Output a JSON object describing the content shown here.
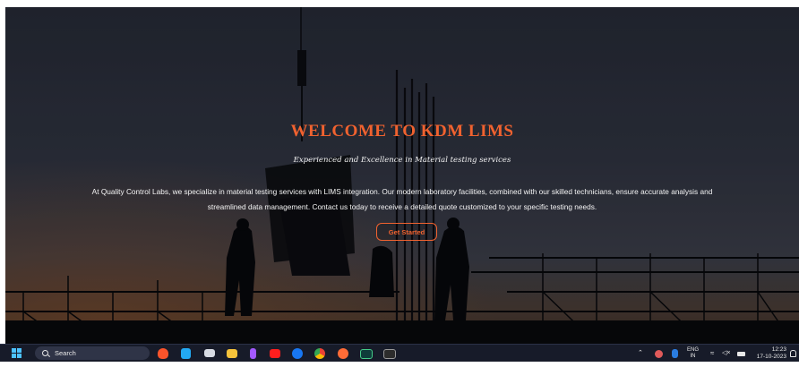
{
  "hero": {
    "title": "WELCOME TO KDM LIMS",
    "subtitle": "Experienced and Excellence in Material testing services",
    "description": "At Quality Control Labs, we specialize in material testing services with LIMS integration. Our modern laboratory facilities, combined with our skilled technicians, ensure accurate analysis and streamlined data management. Contact us today to receive a detailed quote customized to your specific testing needs.",
    "cta_label": "Get Started",
    "accent_color": "#f0622f"
  },
  "taskbar": {
    "search_label": "Search",
    "apps": [
      "brave-browser-icon",
      "vscode-icon",
      "terminal-window-icon",
      "file-explorer-icon",
      "figma-icon",
      "youtube-icon",
      "facebook-icon",
      "chrome-icon",
      "postman-icon",
      "mongodb-compass-icon",
      "command-prompt-icon"
    ],
    "tray": {
      "lang_top": "ENG",
      "lang_bottom": "IN",
      "time": "12:23",
      "date": "17-10-2023"
    }
  }
}
